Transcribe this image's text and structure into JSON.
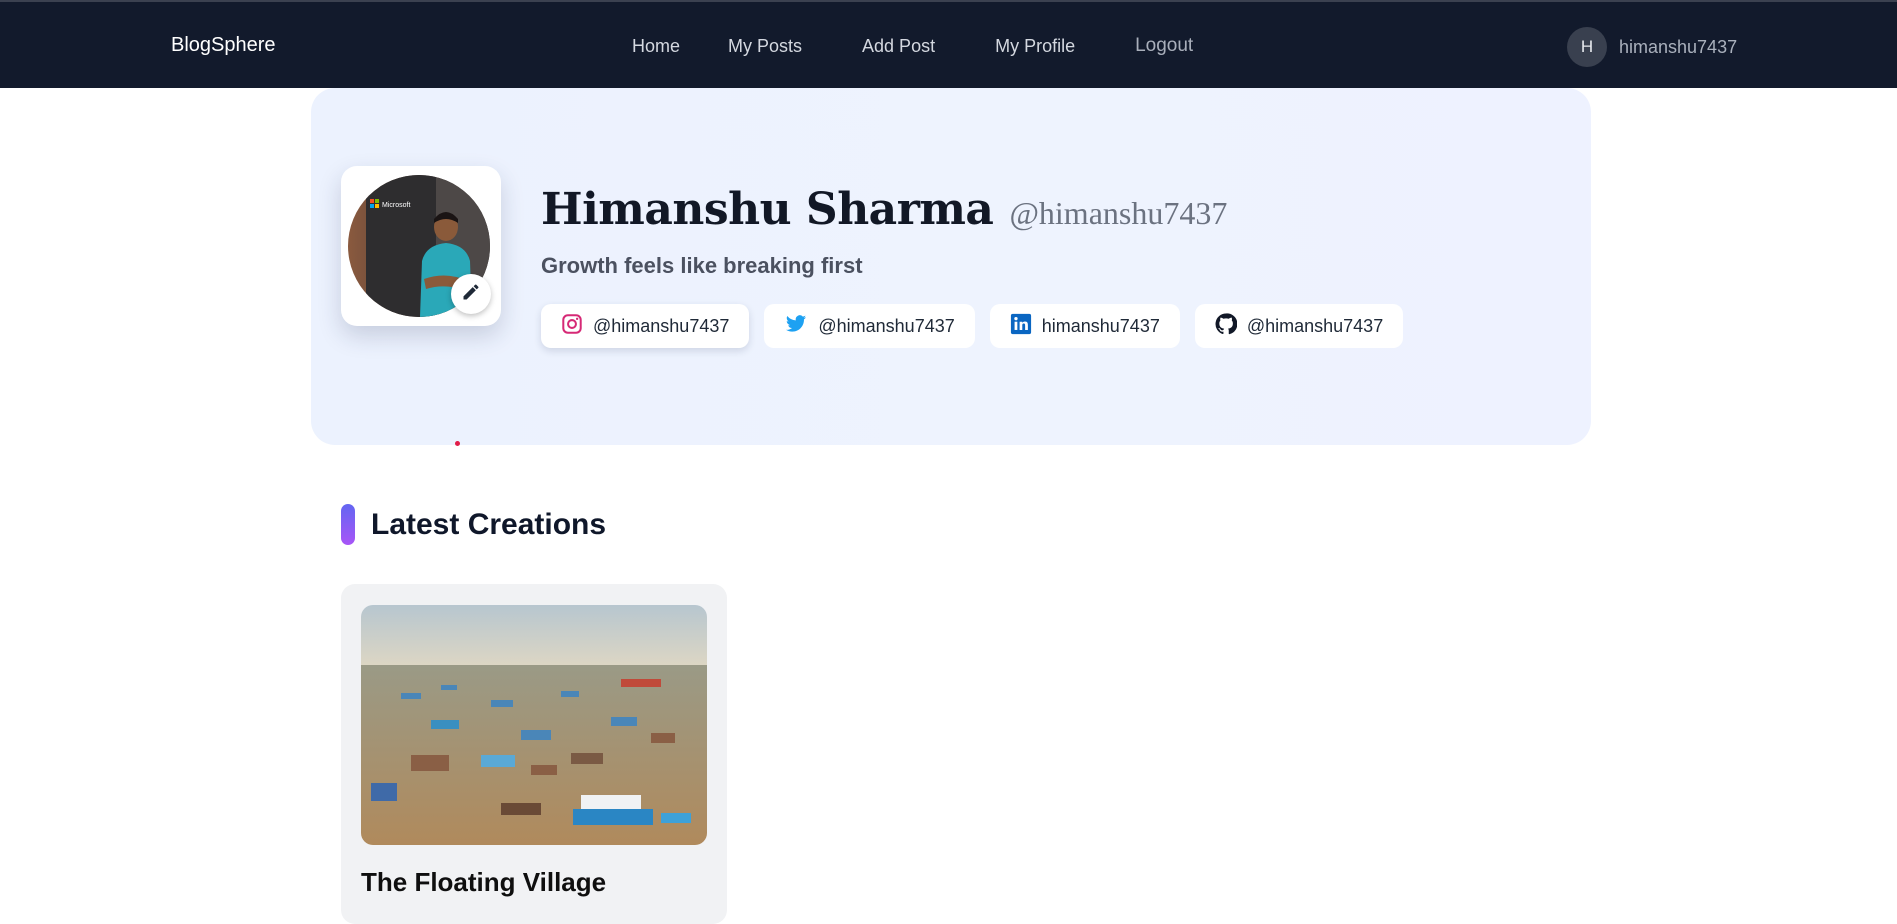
{
  "navbar": {
    "brand": "BlogSphere",
    "links": [
      {
        "label": "Home"
      },
      {
        "label": "My Posts"
      },
      {
        "label": "Add Post"
      },
      {
        "label": "My Profile"
      },
      {
        "label": "Logout"
      }
    ],
    "user": {
      "initial": "H",
      "username": "himanshu7437"
    }
  },
  "profile": {
    "full_name": "Himanshu Sharma",
    "handle": "@himanshu7437",
    "bio": "Growth feels like breaking first",
    "avatar_logo_text": "Microsoft",
    "socials": [
      {
        "platform": "instagram",
        "icon": "instagram-icon",
        "label": "@himanshu7437",
        "color": "#e1306c"
      },
      {
        "platform": "twitter",
        "icon": "twitter-icon",
        "label": "@himanshu7437",
        "color": "#1da1f2"
      },
      {
        "platform": "linkedin",
        "icon": "linkedin-icon",
        "label": "himanshu7437",
        "color": "#0a66c2"
      },
      {
        "platform": "github",
        "icon": "github-icon",
        "label": "@himanshu7437",
        "color": "#111827"
      }
    ]
  },
  "latest": {
    "title": "Latest Creations",
    "posts": [
      {
        "title": "The Floating Village"
      }
    ]
  },
  "colors": {
    "navbar_bg": "#121a2c",
    "profile_bg": "#eef2fe",
    "accent_gradient_start": "#6366f1",
    "accent_gradient_end": "#a855f7"
  }
}
